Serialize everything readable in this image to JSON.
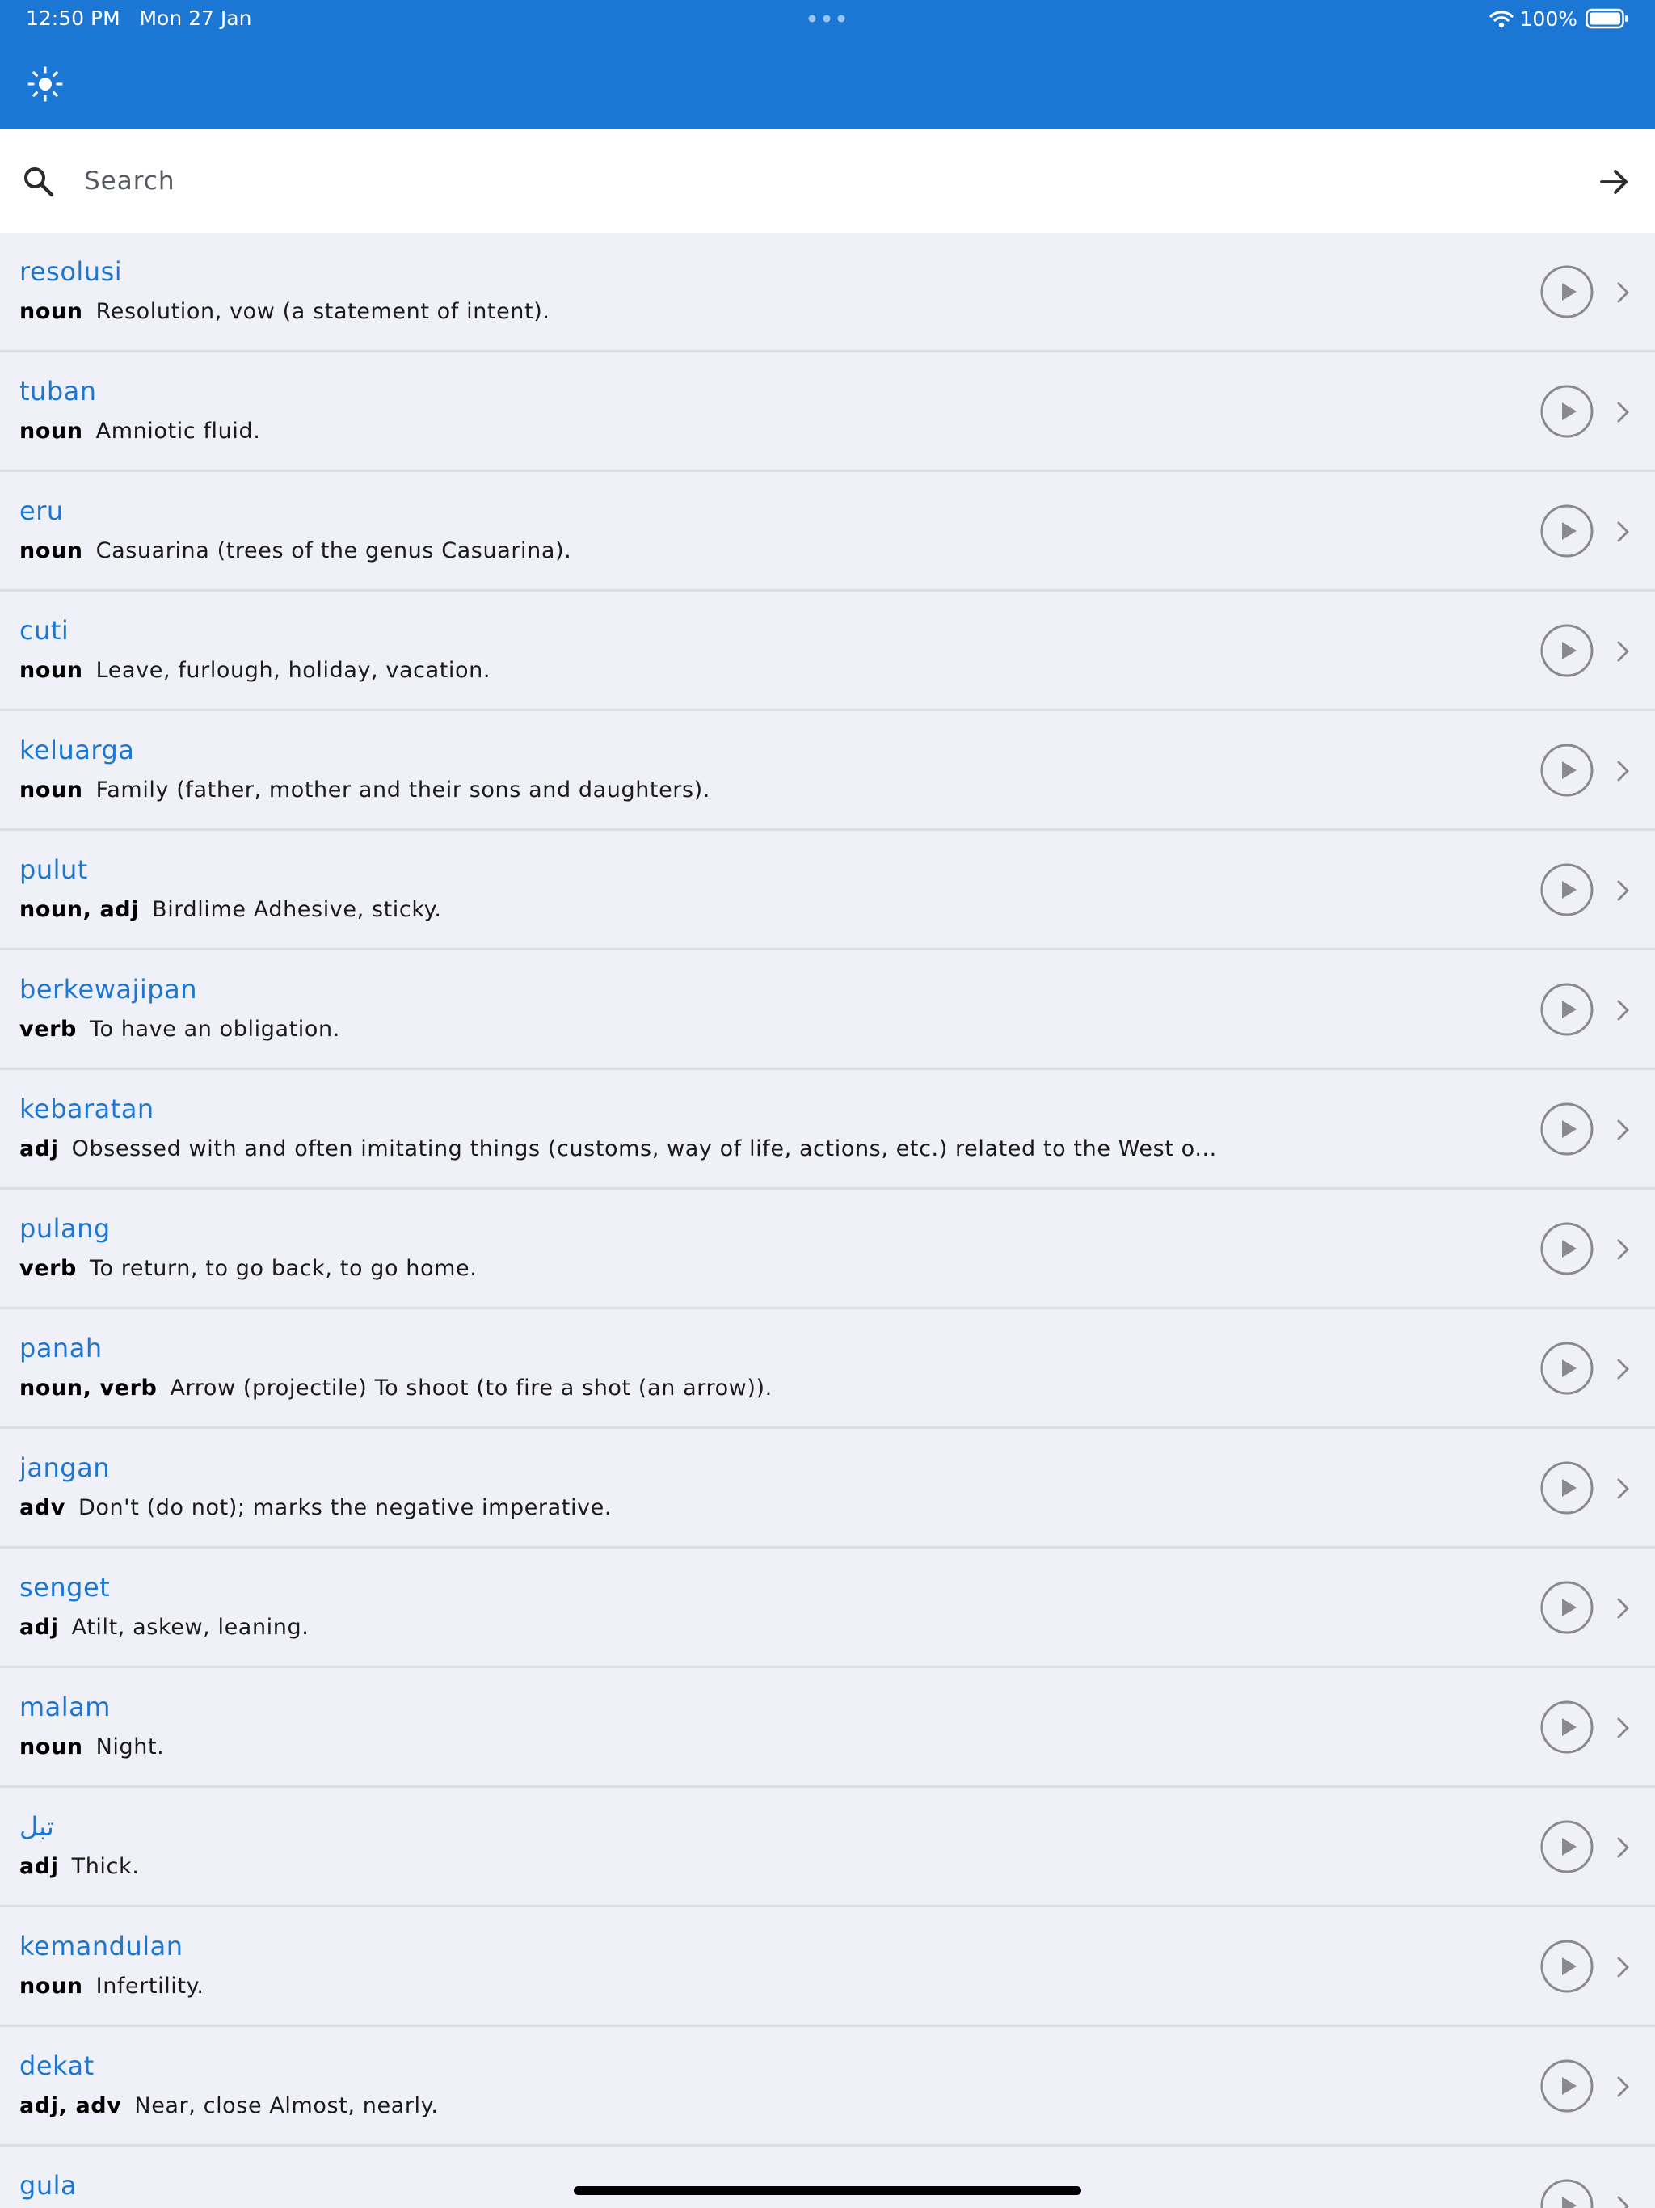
{
  "status_bar": {
    "time": "12:50 PM",
    "date": "Mon 27 Jan",
    "battery": "100%"
  },
  "colors": {
    "accent": "#1b76d4",
    "background": "#f0f1f8",
    "divider": "#dcdde3"
  },
  "header": {
    "theme_icon": "sun-icon"
  },
  "search": {
    "placeholder": "Search",
    "value": "",
    "icon": "search-icon",
    "submit_icon": "arrow-right-icon"
  },
  "entries": [
    {
      "word": "resolusi",
      "pos": "noun",
      "definition": "Resolution, vow (a statement of intent)."
    },
    {
      "word": "tuban",
      "pos": "noun",
      "definition": "Amniotic fluid."
    },
    {
      "word": "eru",
      "pos": "noun",
      "definition": "Casuarina (trees of the genus Casuarina)."
    },
    {
      "word": "cuti",
      "pos": "noun",
      "definition": "Leave, furlough, holiday, vacation."
    },
    {
      "word": "keluarga",
      "pos": "noun",
      "definition": "Family (father, mother and their sons and daughters)."
    },
    {
      "word": "pulut",
      "pos": "noun, adj",
      "definition": "Birdlime Adhesive, sticky."
    },
    {
      "word": "berkewajipan",
      "pos": "verb",
      "definition": "To have an obligation."
    },
    {
      "word": "kebaratan",
      "pos": "adj",
      "definition": "Obsessed with and often imitating things (customs, way of life, actions, etc.) related to the West o..."
    },
    {
      "word": "pulang",
      "pos": "verb",
      "definition": "To return, to go back, to go home."
    },
    {
      "word": "panah",
      "pos": "noun, verb",
      "definition": "Arrow (projectile) To shoot (to fire a shot (an arrow))."
    },
    {
      "word": "jangan",
      "pos": "adv",
      "definition": "Don't (do not); marks the negative imperative."
    },
    {
      "word": "senget",
      "pos": "adj",
      "definition": "Atilt, askew, leaning."
    },
    {
      "word": "malam",
      "pos": "noun",
      "definition": "Night."
    },
    {
      "word": "تبل",
      "pos": "adj",
      "definition": "Thick."
    },
    {
      "word": "kemandulan",
      "pos": "noun",
      "definition": "Infertility."
    },
    {
      "word": "dekat",
      "pos": "adj, adv",
      "definition": "Near, close Almost, nearly."
    },
    {
      "word": "gula",
      "pos": "",
      "definition": ""
    }
  ]
}
